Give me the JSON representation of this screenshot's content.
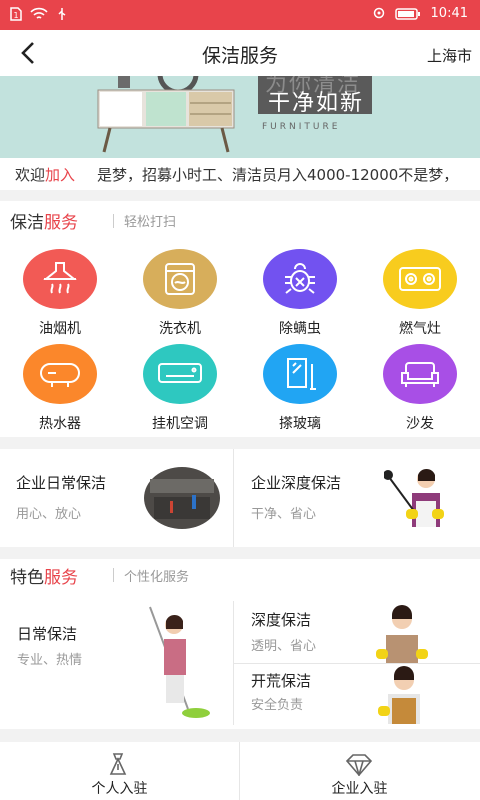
{
  "status_bar": {
    "time": "10:41"
  },
  "nav": {
    "title": "保洁服务",
    "city": "上海市"
  },
  "banner": {
    "headline": "干净如新",
    "faded": "为你清洁",
    "brand": "FURNITURE"
  },
  "marquee": {
    "prefix": "欢迎",
    "prefix_red": "加入",
    "text": "是梦，招募小时工、清洁员月入4000-12000不是梦，"
  },
  "clean_section": {
    "title": "保洁",
    "title_red": "服务",
    "subtitle": "轻松打扫"
  },
  "services": [
    {
      "label": "油烟机",
      "icon": "range-hood-icon",
      "color": "#f25a55"
    },
    {
      "label": "洗衣机",
      "icon": "washing-machine-icon",
      "color": "#d7ae5b"
    },
    {
      "label": "除螨虫",
      "icon": "bug-icon",
      "color": "#7252f0"
    },
    {
      "label": "燃气灶",
      "icon": "gas-stove-icon",
      "color": "#f8cc1e"
    },
    {
      "label": "热水器",
      "icon": "water-heater-icon",
      "color": "#fb872b"
    },
    {
      "label": "挂机空调",
      "icon": "air-conditioner-icon",
      "color": "#2ec8c0"
    },
    {
      "label": "搽玻璃",
      "icon": "glass-icon",
      "color": "#21a5f3"
    },
    {
      "label": "沙发",
      "icon": "sofa-icon",
      "color": "#a84fe6"
    }
  ],
  "enterprise": [
    {
      "title": "企业日常保洁",
      "sub": "用心、放心"
    },
    {
      "title": "企业深度保洁",
      "sub": "干净、省心"
    }
  ],
  "featured_section": {
    "title": "特色",
    "title_red": "服务",
    "subtitle": "个性化服务"
  },
  "featured": [
    {
      "title": "日常保洁",
      "sub": "专业、热情"
    },
    {
      "title": "深度保洁",
      "sub": "透明、省心"
    },
    {
      "title": "开荒保洁",
      "sub": "安全负责"
    }
  ],
  "bottom": [
    {
      "label": "个人入驻",
      "icon": "person-flag-icon"
    },
    {
      "label": "企业入驻",
      "icon": "diamond-icon"
    }
  ]
}
